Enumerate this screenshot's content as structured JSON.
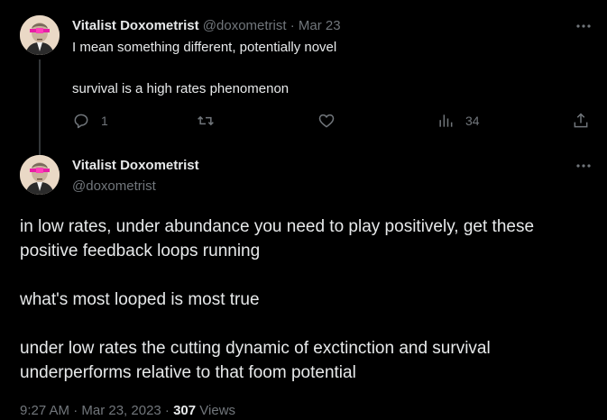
{
  "tweet1": {
    "display_name": "Vitalist Doxometrist",
    "handle": "@doxometrist",
    "separator": " · ",
    "date": "Mar 23",
    "paragraphs": [
      "I mean something different, potentially novel",
      "survival is a high rates phenomenon"
    ],
    "actions": {
      "replies": "1",
      "reposts": "",
      "likes": "",
      "views": "34"
    }
  },
  "tweet2": {
    "display_name": "Vitalist Doxometrist",
    "handle": "@doxometrist",
    "paragraphs": [
      "in low rates, under abundance you need to play positively, get these positive feedback loops running",
      "what's most looped is most true",
      "under low rates the cutting dynamic of exctinction and survival underperforms relative to that foom potential"
    ],
    "timestamp": "9:27 AM · Mar 23, 2023 · ",
    "views_count": "307",
    "views_label": " Views"
  },
  "colors": {
    "background": "#000000",
    "text": "#e7e9ea",
    "muted": "#71767b",
    "thread_line": "#333639"
  },
  "icons": {
    "reply": "reply-icon",
    "repost": "repost-icon",
    "like": "heart-icon",
    "views": "analytics-icon",
    "share": "share-icon",
    "more": "more-dots-icon"
  }
}
